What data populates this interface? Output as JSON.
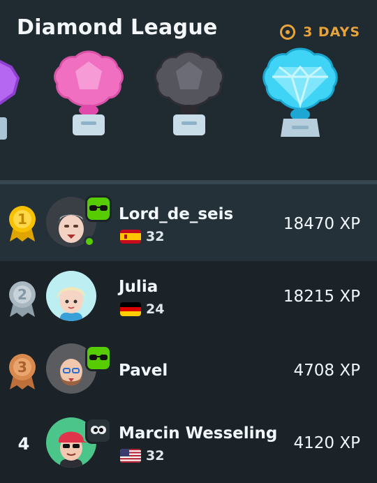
{
  "header": {
    "title": "Diamond League",
    "timer_icon": "clock-icon",
    "timer_text": "3 DAYS",
    "timer_color": "#e8a33a"
  },
  "trophies": [
    {
      "league": "amethyst",
      "icon": "amethyst-trophy-icon",
      "color": "#b667f1"
    },
    {
      "league": "pearl",
      "icon": "pearl-trophy-icon",
      "color": "#f285c8"
    },
    {
      "league": "obsidian",
      "icon": "obsidian-trophy-icon",
      "color": "#5a5a62"
    },
    {
      "league": "diamond",
      "icon": "diamond-trophy-icon",
      "color": "#3fd3f5"
    }
  ],
  "leaderboard": [
    {
      "rank": "1",
      "medal": "gold-medal-icon",
      "name": "Lord_de_seis",
      "flag": "spain-flag-icon",
      "meta_value": "32",
      "xp": "18470 XP",
      "badge": "cool-owl-badge-icon",
      "online": true,
      "highlighted": true
    },
    {
      "rank": "2",
      "medal": "silver-medal-icon",
      "name": "Julia",
      "flag": "germany-flag-icon",
      "meta_value": "24",
      "xp": "18215 XP",
      "badge": null,
      "online": false,
      "highlighted": false
    },
    {
      "rank": "3",
      "medal": "bronze-medal-icon",
      "name": "Pavel",
      "flag": null,
      "meta_value": null,
      "xp": "4708 XP",
      "badge": "cool-owl-badge-icon",
      "online": false,
      "highlighted": false
    },
    {
      "rank": "4",
      "medal": null,
      "name": "Marcin Wesseling",
      "flag": "usa-flag-icon",
      "meta_value": "32",
      "xp": "4120 XP",
      "badge": "dark-eyes-badge-icon",
      "online": false,
      "highlighted": false
    }
  ],
  "colors": {
    "background": "#1b2329",
    "header_background": "#1f2a31",
    "highlight_row": "#253139",
    "gold": "#f7c000",
    "silver": "#a9b7c0",
    "bronze": "#d8894e",
    "online": "#58cc02"
  }
}
